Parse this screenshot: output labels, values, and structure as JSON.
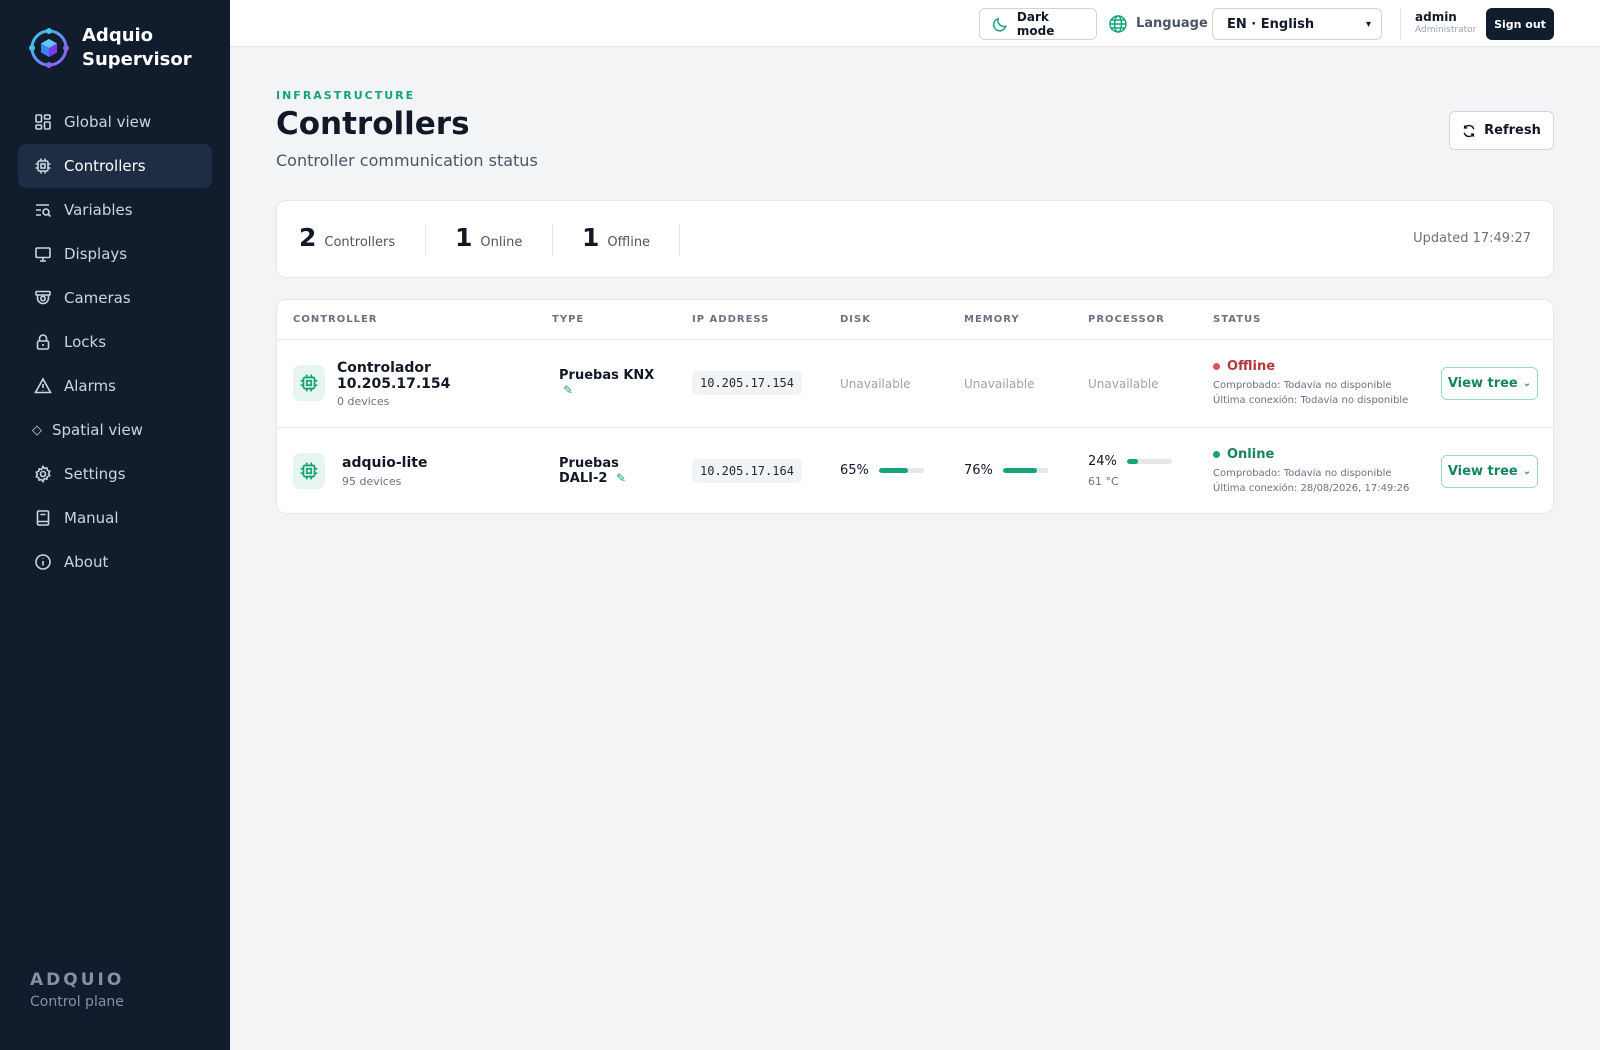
{
  "brand": {
    "name": "Adquio Supervisor"
  },
  "sidebar": {
    "items": [
      {
        "label": "Global view",
        "icon": "grid-icon"
      },
      {
        "label": "Controllers",
        "icon": "chip-icon",
        "active": true
      },
      {
        "label": "Variables",
        "icon": "variables-icon"
      },
      {
        "label": "Displays",
        "icon": "monitor-icon"
      },
      {
        "label": "Cameras",
        "icon": "camera-icon"
      },
      {
        "label": "Locks",
        "icon": "lock-icon"
      },
      {
        "label": "Alarms",
        "icon": "alert-icon"
      },
      {
        "label": "Spatial view",
        "icon": "diamond-icon"
      },
      {
        "label": "Settings",
        "icon": "gear-icon"
      },
      {
        "label": "Manual",
        "icon": "book-icon"
      },
      {
        "label": "About",
        "icon": "info-icon"
      }
    ],
    "footer": {
      "title": "ADQUIO",
      "subtitle": "Control plane"
    }
  },
  "topbar": {
    "dark_mode_label": "Dark mode",
    "language_label": "Language",
    "language_value": "EN · English",
    "user_name": "admin",
    "user_role": "Administrator",
    "signout_label": "Sign out"
  },
  "header": {
    "eyebrow": "INFRASTRUCTURE",
    "title": "Controllers",
    "subtitle": "Controller communication status",
    "refresh_label": "Refresh"
  },
  "summary": {
    "total": {
      "num": "2",
      "label": "Controllers"
    },
    "online": {
      "num": "1",
      "label": "Online"
    },
    "offline": {
      "num": "1",
      "label": "Offline"
    },
    "updated": "Updated 17:49:27"
  },
  "table": {
    "columns": [
      "CONTROLLER",
      "TYPE",
      "IP ADDRESS",
      "DISK",
      "MEMORY",
      "PROCESSOR",
      "STATUS"
    ],
    "rows": [
      {
        "name": "Controlador 10.205.17.154",
        "devices": "0 devices",
        "type": "Pruebas KNX",
        "ip": "10.205.17.154",
        "disk": "Unavailable",
        "memory": "Unavailable",
        "processor": "Unavailable",
        "status": "Offline",
        "checked": "Comprobado: Todavía no disponible",
        "last_connection": "Última conexión: Todavía no disponible",
        "action": "View tree"
      },
      {
        "name": "adquio-lite",
        "devices": "95 devices",
        "type": "Pruebas DALI-2",
        "ip": "10.205.17.164",
        "disk": "65%",
        "disk_pct": 65,
        "memory": "76%",
        "memory_pct": 76,
        "processor": "24%",
        "processor_pct": 24,
        "temperature": "61 °C",
        "status": "Online",
        "checked": "Comprobado: Todavía no disponible",
        "last_connection": "Última conexión: 28/08/2026, 17:49:26",
        "action": "View tree"
      }
    ]
  },
  "colors": {
    "accent": "#16a37a",
    "offline": "#e05252",
    "sidebar": "#111c2d"
  }
}
